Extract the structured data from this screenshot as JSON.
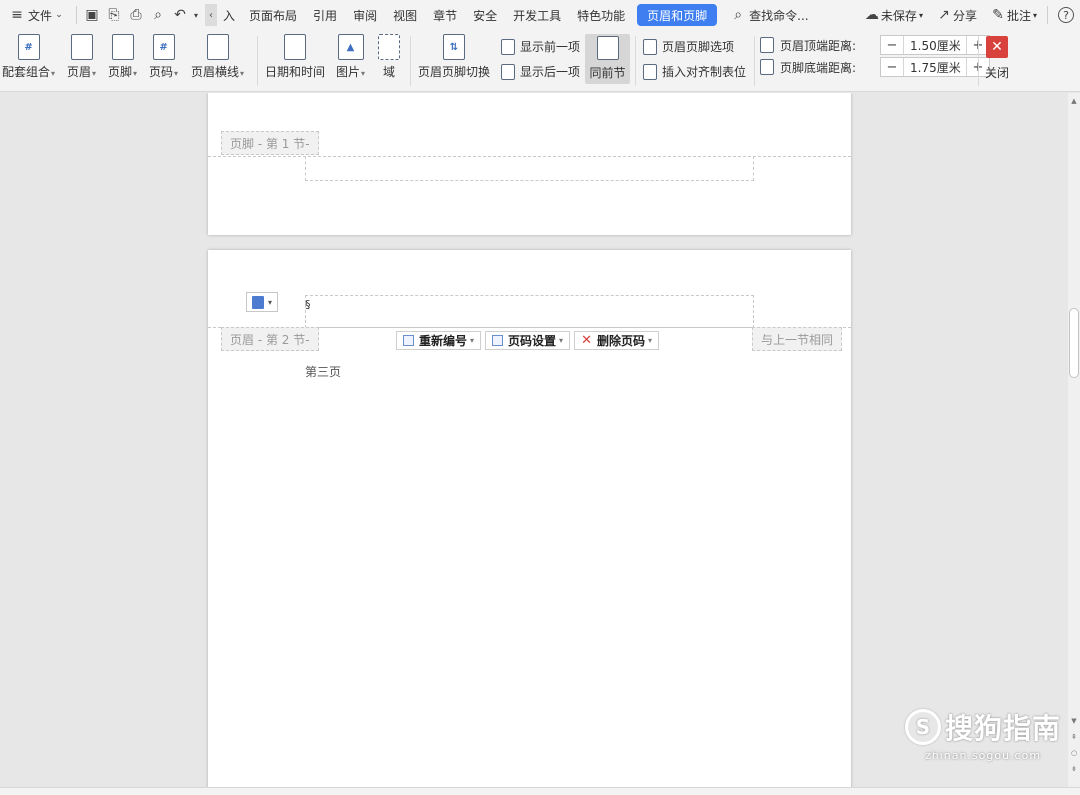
{
  "menubar": {
    "file_label": "文件",
    "truncated_tab": "入",
    "tabs": [
      "页面布局",
      "引用",
      "审阅",
      "视图",
      "章节",
      "安全",
      "开发工具",
      "特色功能",
      "页眉和页脚"
    ],
    "search_label": "查找命令...",
    "unsaved_label": "未保存",
    "share_label": "分享",
    "comment_label": "批注",
    "help_symbol": "?"
  },
  "ribbon": {
    "combo_label": "配套组合",
    "header_label": "页眉",
    "footer_label": "页脚",
    "pagenum_label": "页码",
    "header_line_label": "页眉横线",
    "datetime_label": "日期和时间",
    "picture_label": "图片",
    "field_label": "域",
    "switch_label": "页眉页脚切换",
    "show_prev_label": "显示前一项",
    "show_next_label": "显示后一项",
    "same_prev_label": "同前节",
    "hf_options_label": "页眉页脚选项",
    "insert_tab_label": "插入对齐制表位",
    "header_dist_label": "页眉顶端距离:",
    "header_dist_value": "1.50厘米",
    "footer_dist_label": "页脚底端距离:",
    "footer_dist_value": "1.75厘米",
    "minus_symbol": "−",
    "plus_symbol": "+",
    "close_label": "关闭",
    "close_symbol": "✕"
  },
  "document": {
    "page1_footer_tag": "页脚 - 第 1 节-",
    "page2_header_tag": "页眉 - 第 2 节-",
    "same_as_prev_tag": "与上一节相同",
    "renumber_label": "重新编号",
    "pagenum_settings_label": "页码设置",
    "delete_pagenum_label": "删除页码",
    "body_text": "第三页",
    "cursor_char": "§"
  },
  "watermark": {
    "logo_char": "S",
    "brand": "搜狗指南",
    "url": "zhinan.sogou.com"
  },
  "colors": {
    "accent": "#3e7ef1",
    "close": "#d9413c"
  }
}
